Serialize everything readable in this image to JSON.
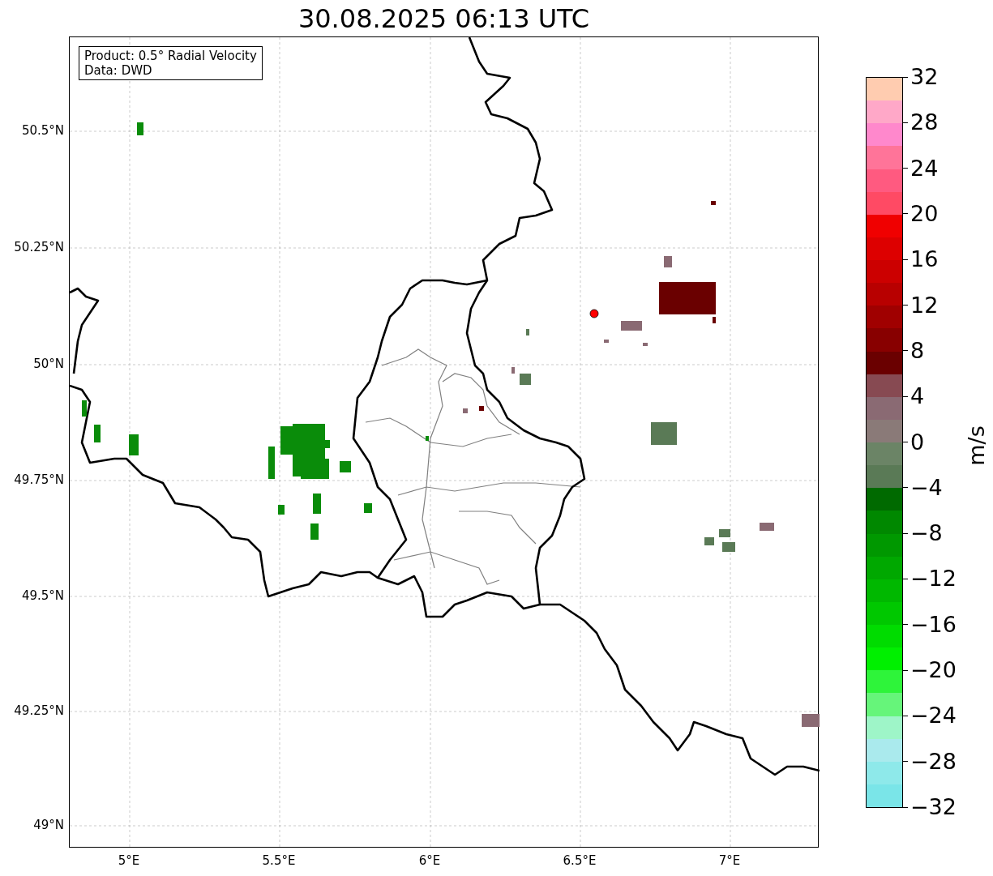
{
  "title": "30.08.2025 06:13 UTC",
  "info_box": [
    "Product: 0.5° Radial Velocity",
    "Data: DWD"
  ],
  "y_ticks": [
    "50.5°N",
    "50.25°N",
    "50°N",
    "49.75°N",
    "49.5°N",
    "49.25°N",
    "49°N"
  ],
  "x_ticks": [
    "5°E",
    "5.5°E",
    "6°E",
    "6.5°E",
    "7°E"
  ],
  "colorbar": {
    "label": "m/s",
    "ticks": [
      "32",
      "28",
      "24",
      "20",
      "16",
      "12",
      "8",
      "4",
      "0",
      "−4",
      "−8",
      "−12",
      "−16",
      "−20",
      "−24",
      "−28",
      "−32"
    ],
    "bands": [
      {
        "color": "#7ae5e8"
      },
      {
        "color": "#8ee9ea"
      },
      {
        "color": "#aaeaed"
      },
      {
        "color": "#9ef5c8"
      },
      {
        "color": "#66f57a"
      },
      {
        "color": "#2ef43a"
      },
      {
        "color": "#00f000"
      },
      {
        "color": "#00dc00"
      },
      {
        "color": "#00c800"
      },
      {
        "color": "#00b800"
      },
      {
        "color": "#00a800"
      },
      {
        "color": "#009800"
      },
      {
        "color": "#008800"
      },
      {
        "color": "#006a00"
      },
      {
        "color": "#5a7a56"
      },
      {
        "color": "#6b8466"
      },
      {
        "color": "#8a7a78"
      },
      {
        "color": "#8a6a73"
      },
      {
        "color": "#874a52"
      },
      {
        "color": "#6a0000"
      },
      {
        "color": "#880000"
      },
      {
        "color": "#a00000"
      },
      {
        "color": "#b80000"
      },
      {
        "color": "#cc0000"
      },
      {
        "color": "#dd0000"
      },
      {
        "color": "#f00000"
      },
      {
        "color": "#ff4a64"
      },
      {
        "color": "#ff5a80"
      },
      {
        "color": "#ff7499"
      },
      {
        "color": "#ff88cc"
      },
      {
        "color": "#ffa8c8"
      },
      {
        "color": "#ffccb0"
      }
    ]
  }
}
